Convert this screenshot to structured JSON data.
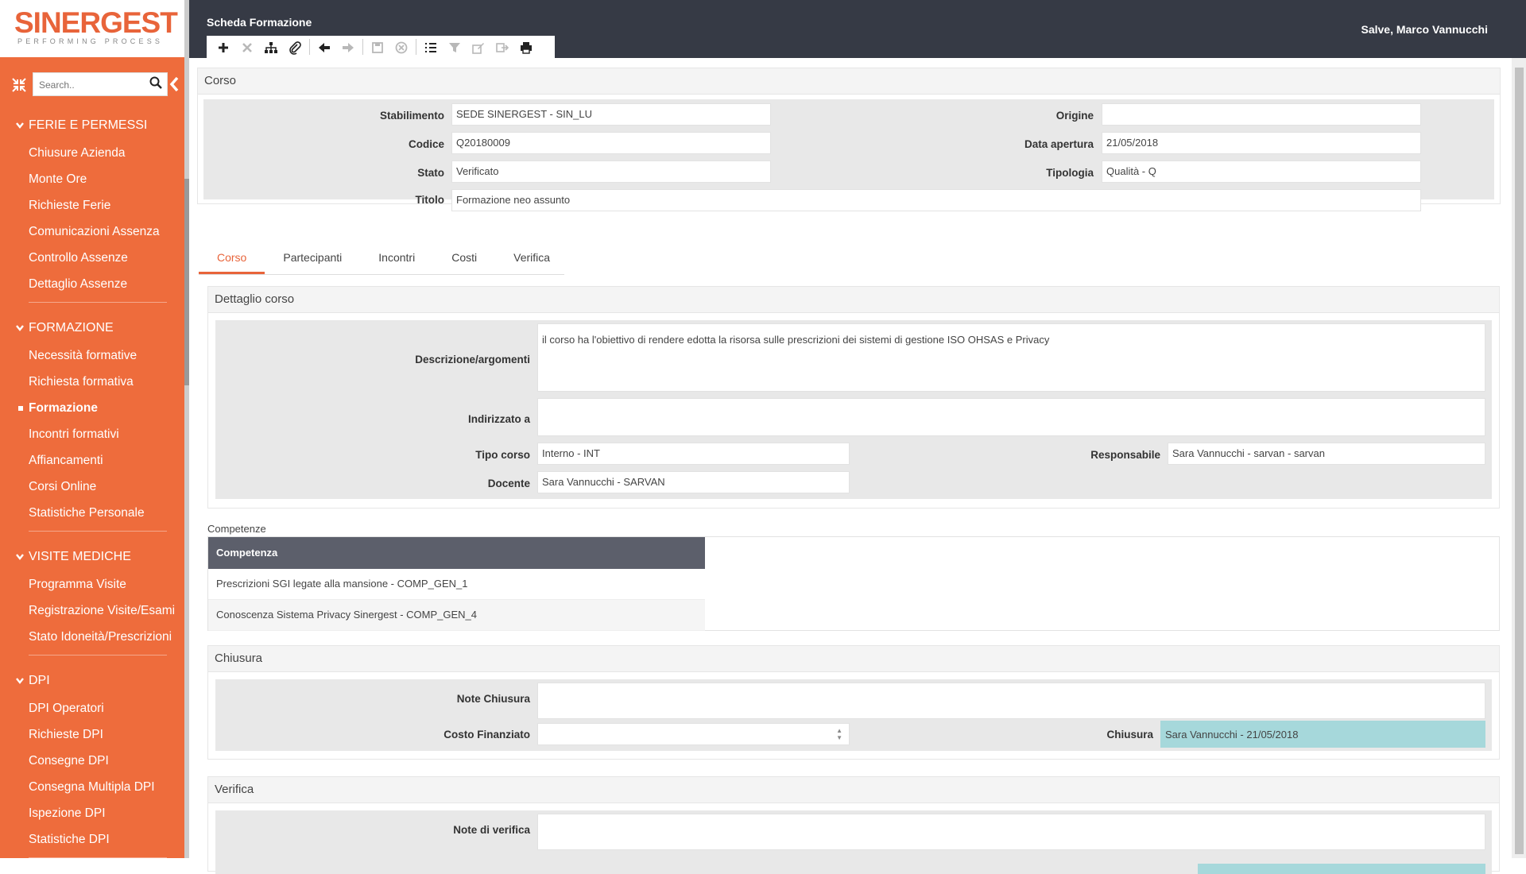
{
  "brand": {
    "name": "SINERGEST",
    "tagline": "PERFORMING PROCESS",
    "accent": "#ee6c3c",
    "header_bg": "#363a45"
  },
  "header": {
    "page_title": "Scheda Formazione",
    "greeting": "Salve, Marco Vannucchi"
  },
  "search": {
    "placeholder": "Search..",
    "value": ""
  },
  "toolbar": {
    "buttons": [
      {
        "icon": "plus-icon",
        "enabled": true
      },
      {
        "icon": "delete-x-icon",
        "enabled": false
      },
      {
        "icon": "hierarchy-icon",
        "enabled": true
      },
      {
        "icon": "paperclip-icon",
        "enabled": true
      },
      {
        "icon": "arrow-left-icon",
        "enabled": true
      },
      {
        "icon": "arrow-right-icon",
        "enabled": false
      },
      {
        "icon": "save-icon",
        "enabled": false
      },
      {
        "icon": "cancel-circle-icon",
        "enabled": false
      },
      {
        "icon": "list-icon",
        "enabled": true
      },
      {
        "icon": "filter-icon",
        "enabled": false
      },
      {
        "icon": "edit-icon",
        "enabled": false
      },
      {
        "icon": "export-icon",
        "enabled": false
      },
      {
        "icon": "print-icon",
        "enabled": true
      }
    ]
  },
  "sidebar": {
    "sections": [
      {
        "title": "FERIE E PERMESSI",
        "items": [
          "Chiusure Azienda",
          "Monte Ore",
          "Richieste Ferie",
          "Comunicazioni Assenza",
          "Controllo Assenze",
          "Dettaglio Assenze"
        ]
      },
      {
        "title": "FORMAZIONE",
        "items": [
          "Necessità formative",
          "Richiesta formativa",
          "Formazione",
          "Incontri formativi",
          "Affiancamenti",
          "Corsi Online",
          "Statistiche Personale"
        ],
        "active": "Formazione"
      },
      {
        "title": "VISITE MEDICHE",
        "items": [
          "Programma Visite",
          "Registrazione Visite/Esami",
          "Stato Idoneità/Prescrizioni"
        ]
      },
      {
        "title": "DPI",
        "items": [
          "DPI Operatori",
          "Richieste DPI",
          "Consegne DPI",
          "Consegna Multipla DPI",
          "Ispezione DPI",
          "Statistiche DPI"
        ]
      }
    ]
  },
  "corso": {
    "title": "Corso",
    "stabilimento_label": "Stabilimento",
    "stabilimento": "SEDE SINERGEST - SIN_LU",
    "codice_label": "Codice",
    "codice": "Q20180009",
    "stato_label": "Stato",
    "stato": "Verificato",
    "titolo_label": "Titolo",
    "titolo": "Formazione neo assunto",
    "origine_label": "Origine",
    "origine": "",
    "data_apertura_label": "Data apertura",
    "data_apertura": "21/05/2018",
    "tipologia_label": "Tipologia",
    "tipologia": "Qualità - Q"
  },
  "tabs": [
    "Corso",
    "Partecipanti",
    "Incontri",
    "Costi",
    "Verifica"
  ],
  "dettaglio": {
    "title": "Dettaglio corso",
    "descrizione_label": "Descrizione/argomenti",
    "descrizione": "il corso ha l'obiettivo di rendere edotta la risorsa sulle prescrizioni dei sistemi di gestione ISO OHSAS e Privacy",
    "indirizzato_label": "Indirizzato a",
    "indirizzato": "",
    "tipo_corso_label": "Tipo corso",
    "tipo_corso": "Interno - INT",
    "docente_label": "Docente",
    "docente": "Sara Vannucchi - SARVAN",
    "responsabile_label": "Responsabile",
    "responsabile": "Sara Vannucchi - sarvan - sarvan"
  },
  "competenze": {
    "label": "Competenze",
    "column": "Competenza",
    "rows": [
      "Prescrizioni SGI legate alla mansione - COMP_GEN_1",
      "Conoscenza Sistema Privacy Sinergest - COMP_GEN_4"
    ]
  },
  "chiusura": {
    "title": "Chiusura",
    "note_label": "Note Chiusura",
    "note": "",
    "costo_label": "Costo Finanziato",
    "costo": "",
    "chiusura_label": "Chiusura",
    "chiusura_value": "Sara Vannucchi - 21/05/2018"
  },
  "verifica": {
    "title": "Verifica",
    "note_label": "Note di verifica",
    "note": ""
  }
}
